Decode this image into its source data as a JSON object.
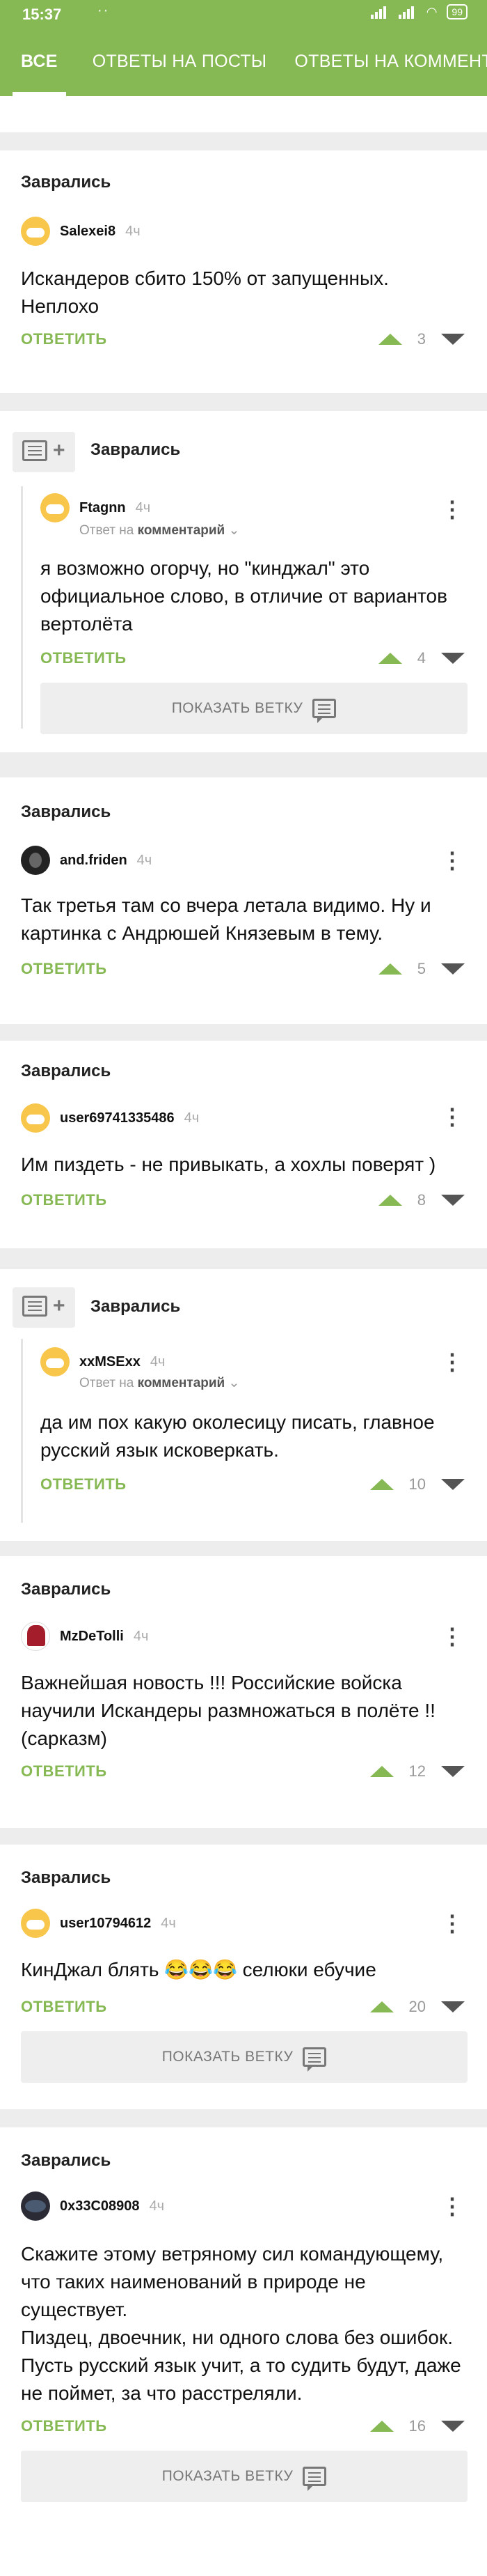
{
  "status_bar": {
    "time": "15:37",
    "dots": "··",
    "battery": "99"
  },
  "tabs": [
    "ВСЕ",
    "ОТВЕТЫ НА ПОСТЫ",
    "ОТВЕТЫ НА КОММЕНТАРИИ"
  ],
  "common": {
    "reply_label": "ОТВЕТИТЬ",
    "show_branch_label": "ПОКАЗАТЬ ВЕТКУ",
    "answer_on_prefix": "Ответ на",
    "answer_on_target": "комментарий",
    "menu_glyph": "⋮"
  },
  "comments": [
    {
      "post_title": "Заврались",
      "user": "Salexei8",
      "time": "4ч",
      "text": "Искандеров сбито 150% от запущенных.\nНеплохо",
      "rating": "3"
    },
    {
      "post_title": "Заврались",
      "user": "Ftagnn",
      "time": "4ч",
      "text": "я возможно огорчу, но \"кинджал\" это официальное слово, в отличие от вариантов вертолёта",
      "rating": "4"
    },
    {
      "post_title": "Заврались",
      "user": "and.friden",
      "time": "4ч",
      "text": "Так третья там со вчера летала видимо. Ну и картинка с Андрюшей Князевым в тему.",
      "rating": "5"
    },
    {
      "post_title": "Заврались",
      "user": "user69741335486",
      "time": "4ч",
      "text": "Им пиздеть - не привыкать, а хохлы поверят )",
      "rating": "8"
    },
    {
      "post_title": "Заврались",
      "user": "xxMSExx",
      "time": "4ч",
      "text": "да им пох какую околесицу писать, главное русский язык исковеркать.",
      "rating": "10"
    },
    {
      "post_title": "Заврались",
      "user": "MzDeTolli",
      "time": "4ч",
      "text": "Важнейшая новость !!! Российские войска научили Искандеры размножаться в полёте !! (сарказм)",
      "rating": "12"
    },
    {
      "post_title": "Заврались",
      "user": "user10794612",
      "time": "4ч",
      "text": "КинДжал блять 😂😂😂 селюки ебучие",
      "rating": "20"
    },
    {
      "post_title": "Заврались",
      "user": "0x33C08908",
      "time": "4ч",
      "text": "Скажите этому ветряному сил командующему, что таких наименований в природе не существует.\nПиздец, двоечник, ни одного слова без ошибок. Пусть русский язык учит, а то судить будут, даже не поймет, за что расстреляли.",
      "rating": "16"
    }
  ],
  "colors": {
    "accent": "#86b854",
    "background": "#ededed",
    "card": "#ffffff"
  }
}
